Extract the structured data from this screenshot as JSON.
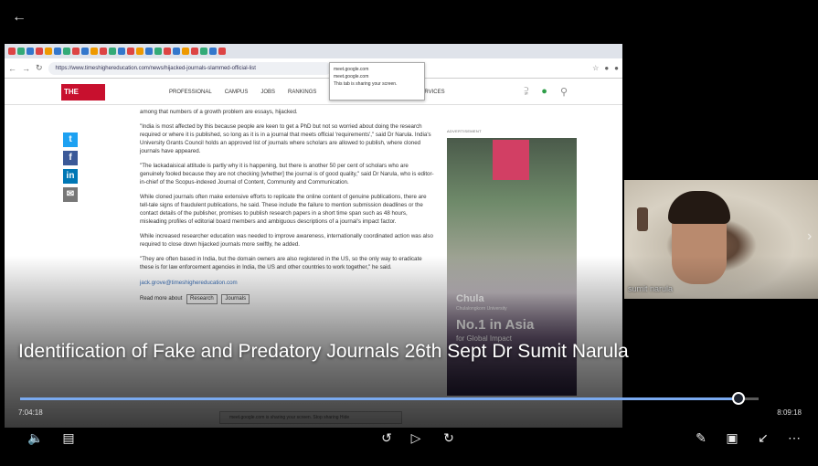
{
  "player": {
    "title": "Identification of Fake and Predatory Journals 26th Sept Dr Sumit Narula",
    "time_current": "7:04:18",
    "time_total": "8:09:18",
    "progress": 0.973,
    "accent_color": "#7aaaf0"
  },
  "participant": {
    "name": "sumit narula"
  },
  "icons": {
    "back": "back-arrow-icon",
    "prev": "chevron-left-icon",
    "next": "chevron-right-icon",
    "volume": "volume-icon",
    "captions": "captions-icon",
    "rewind": "rewind-10-icon",
    "play": "play-icon",
    "forward": "forward-10-icon",
    "edit": "pen-icon",
    "miniplayer": "miniplayer-icon",
    "collapse": "collapse-icon",
    "more": "more-icon"
  },
  "shared_screen": {
    "url": "https://www.timeshighereducation.com/news/hijacked-journals-slammed-official-list",
    "popup_lines": [
      "meet.google.com",
      "meet.google.com",
      "This tab is sharing your screen."
    ],
    "site": {
      "logo": "THE",
      "nav": [
        "PROFESSIONAL",
        "CAMPUS",
        "JOBS",
        "RANKINGS"
      ],
      "nav_services": "SERVICES"
    },
    "article": {
      "paragraphs": [
        "among that numbers of a growth problem are essays, hijacked.",
        "\"India is most affected by this because people are keen to get a PhD but not so worried about doing the research required or where it is published, so long as it is in a journal that meets official 'requirements',\" said Dr Narula. India's University Grants Council holds an approved list of journals where scholars are allowed to publish, where cloned journals have appeared.",
        "\"The lackadaisical attitude is partly why it is happening, but there is another 50 per cent of scholars who are genuinely fooled because they are not checking [whether] the journal is of good quality,\" said Dr Narula, who is editor-in-chief of the Scopus-indexed Journal of Content, Community and Communication.",
        "While cloned journals often make extensive efforts to replicate the online content of genuine publications, there are tell-tale signs of fraudulent publications, he said. These include the failure to mention submission deadlines or the contact details of the publisher, promises to publish research papers in a short time span such as 48 hours, misleading profiles of editorial board members and ambiguous descriptions of a journal's impact factor.",
        "While increased researcher education was needed to improve awareness, internationally coordinated action was also required to close down hijacked journals more swiftly, he added.",
        "\"They are often based in India, but the domain owners are also registered in the US, so the only way to eradicate these is for law enforcement agencies in India, the US and other countries to work together,\" he said."
      ],
      "email": "jack.grove@timeshighereducation.com",
      "tags_label": "Read more about",
      "tags": [
        "Research",
        "Journals"
      ]
    },
    "ad": {
      "label": "ADVERTISEMENT",
      "brand": "Chula",
      "tagline": "Chulalongkorn University",
      "rank": "No.1 in Asia",
      "impact": "for Global Impact"
    },
    "toast": "meet.google.com is sharing your screen.    Stop sharing    Hide"
  }
}
